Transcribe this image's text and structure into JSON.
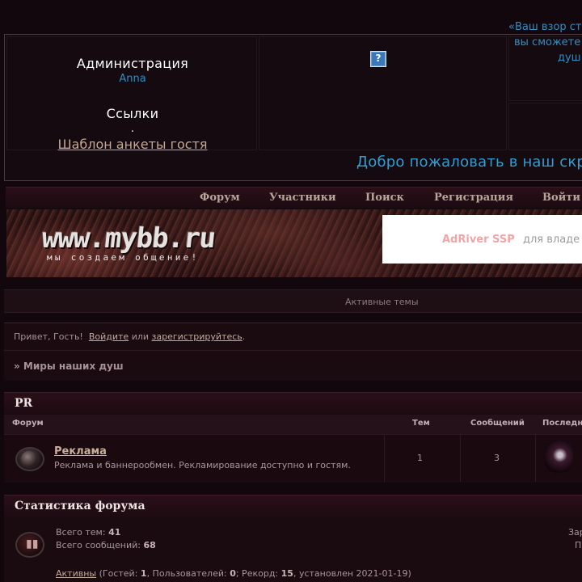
{
  "top_panel": {
    "admin_heading": "Администрация",
    "admin_name": "Anna",
    "links_heading": "Ссылки",
    "links_dot": ".",
    "guest_template_link": "Шаблон анкеты гостя",
    "question_icon_label": "?",
    "quote_line_1": "«Ваш взор ст",
    "quote_line_2": "вы сможете",
    "quote_line_3": "душ",
    "welcome_text": "Добро пожаловать в наш скр"
  },
  "nav": {
    "forum": "Форум",
    "users": "Участники",
    "search": "Поиск",
    "register": "Регистрация",
    "login": "Войти"
  },
  "banner": {
    "logo_text": "www.mybb.ru",
    "tagline": "мы создаем общение!",
    "ad_brand": "AdRiver SSP",
    "ad_desc": "для владе"
  },
  "active_topics": "Активные темы",
  "greeting": {
    "hello": "Привет, Гость!",
    "login_link": "Войдите",
    "or": "или",
    "register_link": "зарегистрируйтесь",
    "end": "."
  },
  "breadcrumbs": "» Миры наших душ",
  "category": {
    "title": "PR",
    "col_forum": "Форум",
    "col_topics": "Тем",
    "col_posts": "Сообщений",
    "col_last": "Последн",
    "forum": {
      "name": "Реклама",
      "description": "Реклама и баннерообмен. Рекламирование доступно и гостям.",
      "topics": "1",
      "posts": "3"
    }
  },
  "stats": {
    "title": "Статистика форума",
    "total_topics_label": "Всего тем:",
    "total_topics": "41",
    "total_posts_label": "Всего сообщений:",
    "total_posts": "68",
    "right_line_1": "Зар",
    "right_line_2": "П",
    "active_link": "Активны",
    "guests_label": "(Гостей:",
    "guests": "1",
    "users_label": ", Пользователей:",
    "users": "0",
    "record_label": "; Рекорд:",
    "record": "15",
    "record_date": ", установлен 2021-01-19)"
  },
  "colors": {
    "accent_blue": "#2f8fc4",
    "link_tan": "#c3a99b",
    "background": "#12070c"
  }
}
